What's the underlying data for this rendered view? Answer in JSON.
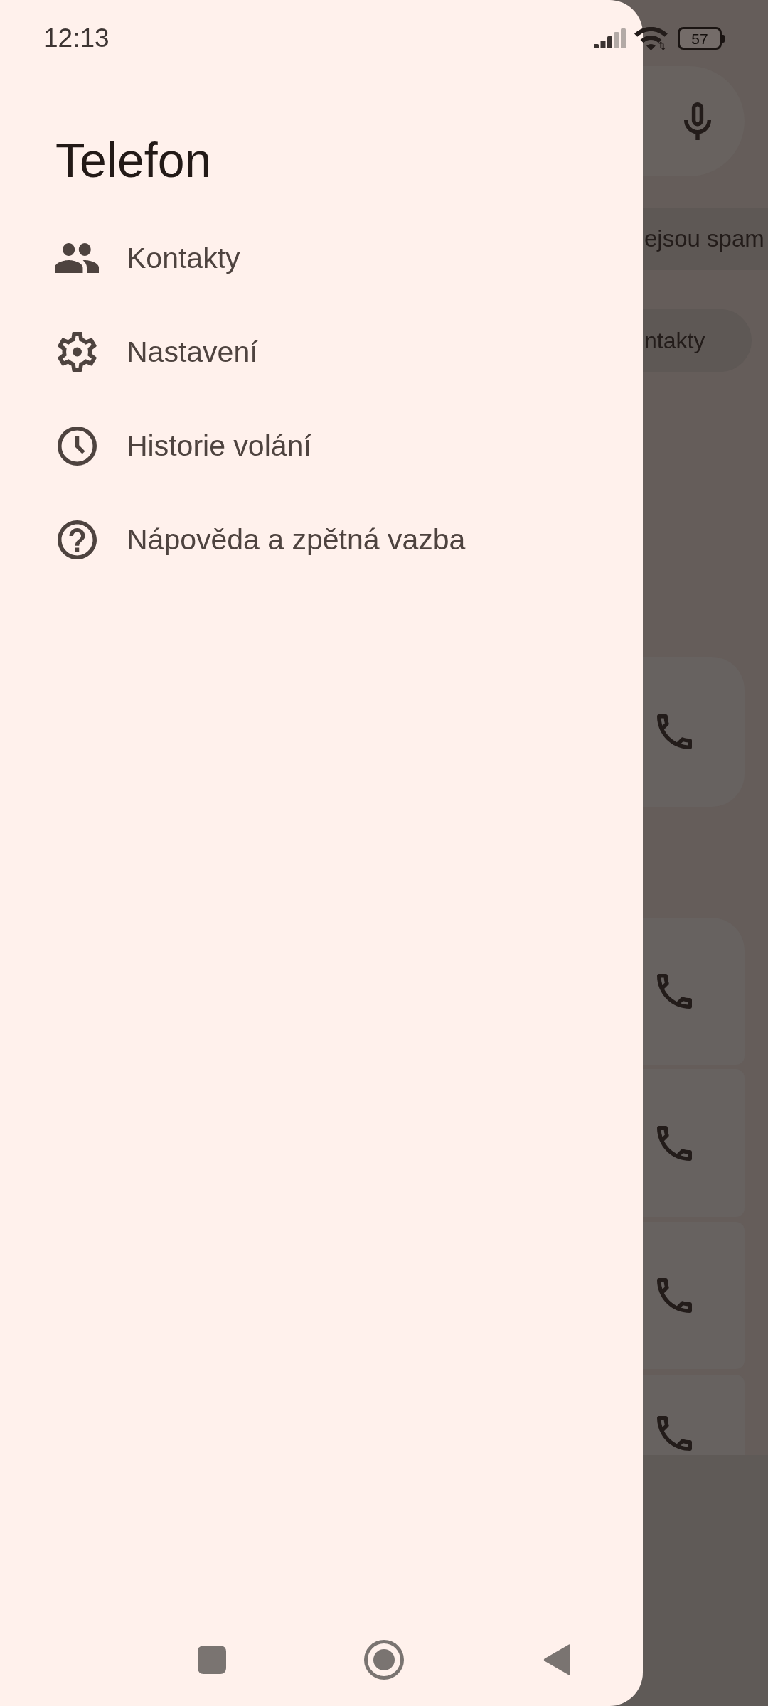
{
  "status_bar": {
    "time": "12:13",
    "battery": "57"
  },
  "background_screen": {
    "banner_text": "ejsou spam",
    "chip_label": "ntakty"
  },
  "drawer": {
    "title": "Telefon",
    "items": [
      {
        "kind": "contacts",
        "label": "Kontakty"
      },
      {
        "kind": "settings",
        "label": "Nastavení"
      },
      {
        "kind": "history",
        "label": "Historie volání"
      },
      {
        "kind": "help",
        "label": "Nápověda a zpětná vazba"
      }
    ]
  }
}
